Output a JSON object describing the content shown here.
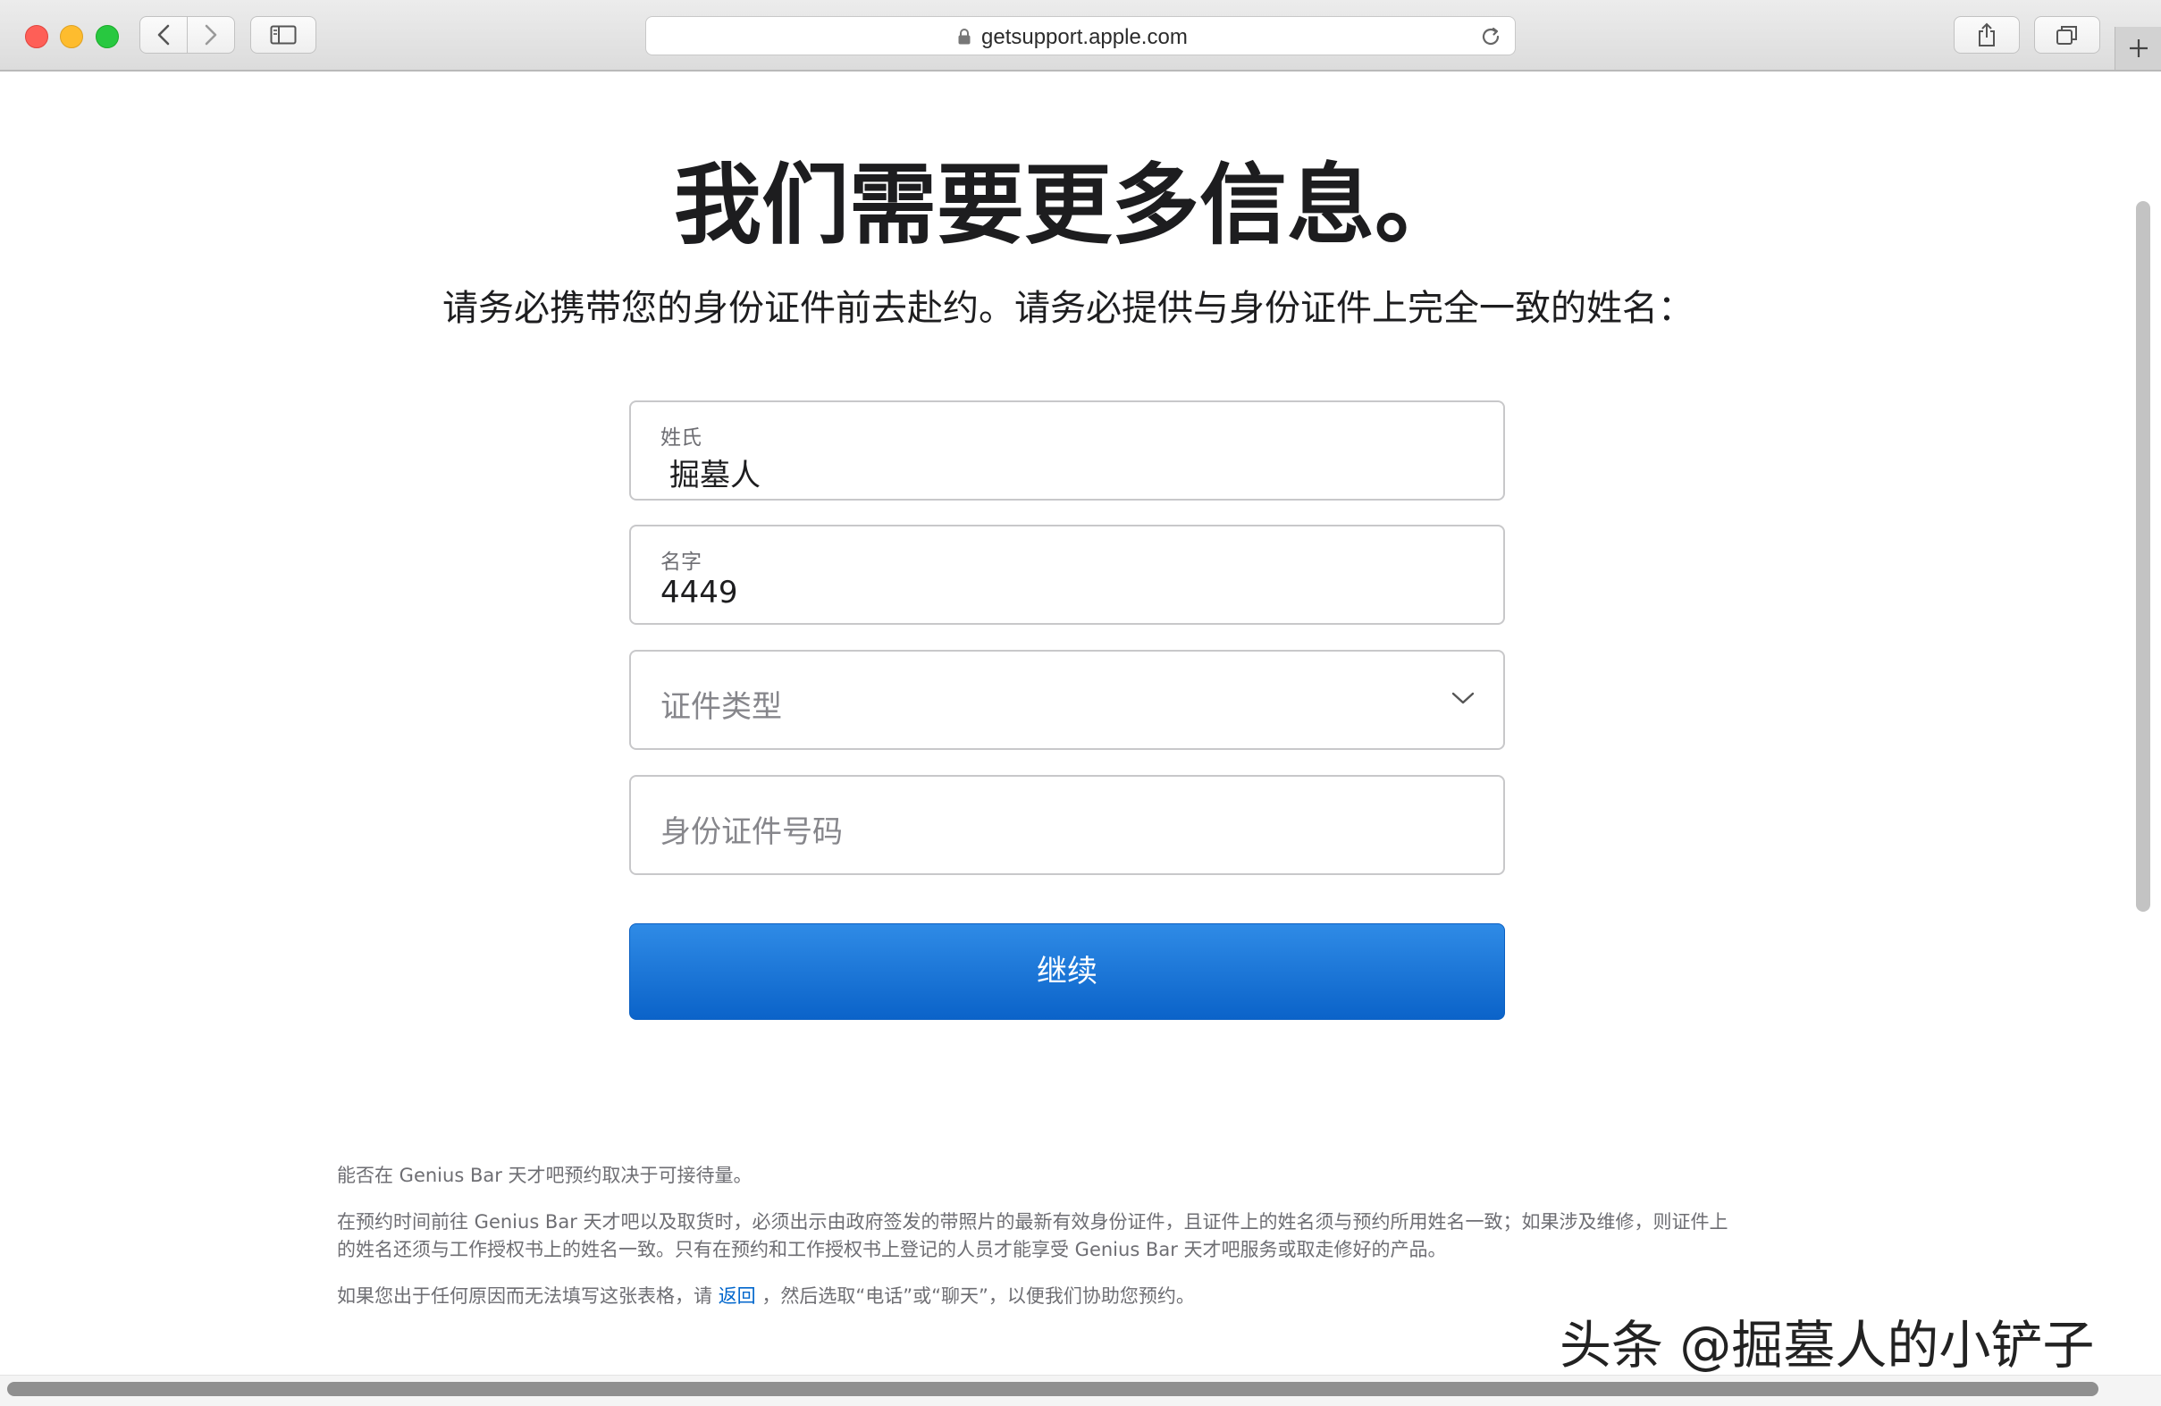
{
  "browser": {
    "url": "getsupport.apple.com"
  },
  "page": {
    "title": "我们需要更多信息。",
    "subtitle": "请务必携带您的身份证件前去赴约。请务必提供与身份证件上完全一致的姓名：",
    "fields": {
      "last_name": {
        "label": "姓氏",
        "value": "掘墓人"
      },
      "first_name": {
        "label": "名字",
        "value": "4449"
      },
      "id_type": {
        "placeholder": "证件类型"
      },
      "id_number": {
        "placeholder": "身份证件号码"
      }
    },
    "continue_label": "继续",
    "notes": {
      "p1": "能否在 Genius Bar 天才吧预约取决于可接待量。",
      "p2_line1": "在预约时间前往 Genius Bar 天才吧以及取货时，必须出示由政府签发的带照片的最新有效身份证件，且证件上的姓名须与预约所用姓名一致；如果涉及维修，则证件上",
      "p2_line2": "的姓名还须与工作授权书上的姓名一致。只有在预约和工作授权书上登记的人员才能享受 Genius Bar 天才吧服务或取走修好的产品。",
      "p3_before": "如果您出于任何原因而无法填写这张表格，请 ",
      "p3_link": "返回",
      "p3_after": " ，然后选取“电话”或“聊天”，以便我们协助您预约。"
    },
    "watermark": "头条 @掘墓人的小铲子"
  },
  "colors": {
    "accent": "#0071e3",
    "link": "#0066cc",
    "text": "#1d1d1f",
    "muted": "#6e6e73"
  }
}
